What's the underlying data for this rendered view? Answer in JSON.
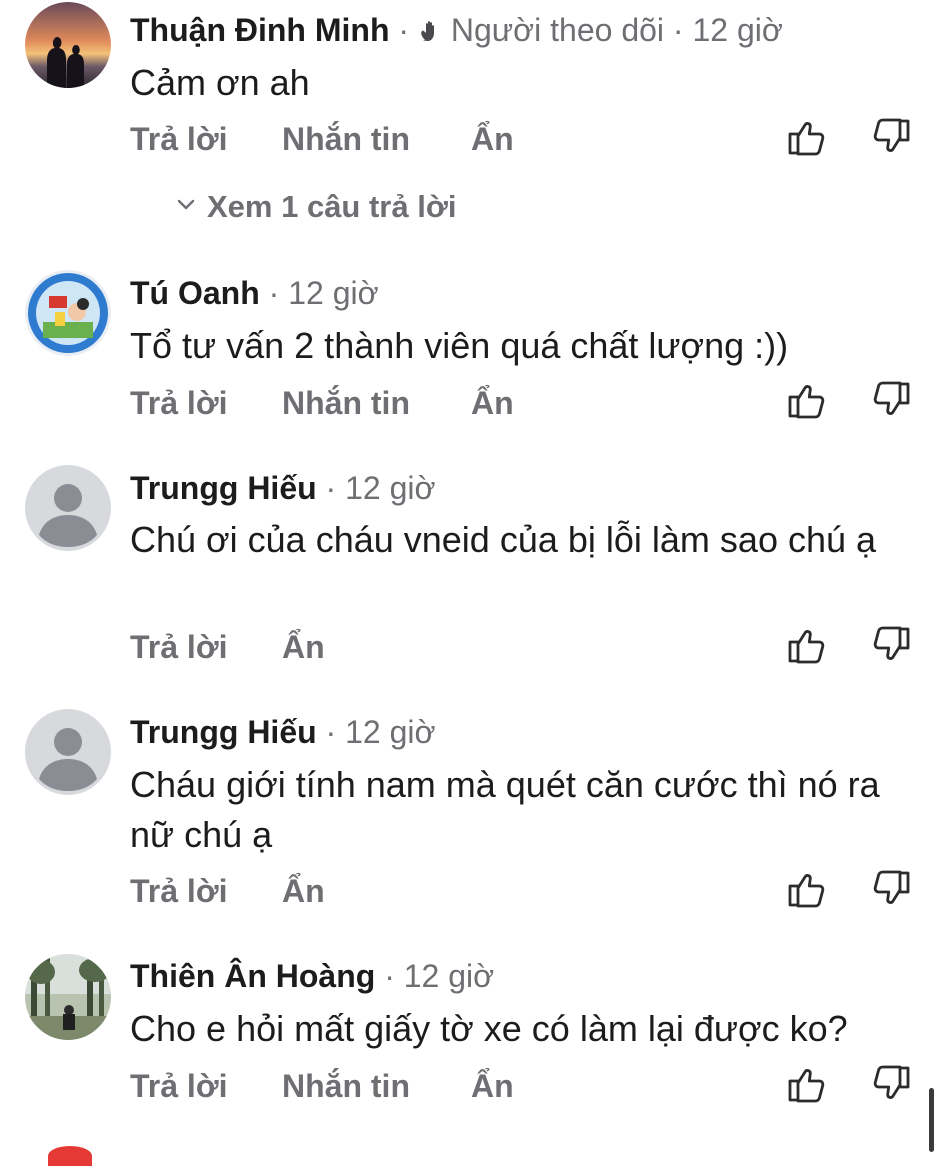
{
  "comments": [
    {
      "author": "Thuận Đinh Minh",
      "badge": "Người theo dõi",
      "time": "· 12 giờ",
      "text": "Cảm ơn ah",
      "actions": [
        "Trả lời",
        "Nhắn tin",
        "Ẩn"
      ],
      "replies_label": "Xem 1 câu trả lời"
    },
    {
      "author": "Tú Oanh",
      "time": "· 12 giờ",
      "text": "Tổ tư vấn 2 thành viên quá chất lượng :))",
      "actions": [
        "Trả lời",
        "Nhắn tin",
        "Ẩn"
      ]
    },
    {
      "author": "Trungg Hiếu",
      "time": "· 12 giờ",
      "text": "Chú ơi của cháu vneid của bị lỗi làm sao chú ạ",
      "actions": [
        "Trả lời",
        "Ẩn"
      ]
    },
    {
      "author": "Trungg Hiếu",
      "time": "· 12 giờ",
      "text": "Cháu giới tính nam mà quét căn cước thì nó ra nữ chú ạ",
      "actions": [
        "Trả lời",
        "Ẩn"
      ]
    },
    {
      "author": "Thiên Ân Hoàng",
      "time": "· 12 giờ",
      "text": "Cho e hỏi mất giấy tờ xe có làm lại được ko?",
      "actions": [
        "Trả lời",
        "Nhắn tin",
        "Ẩn"
      ]
    }
  ],
  "icons": {
    "like": "thumbs-up-icon",
    "dislike": "thumbs-down-icon",
    "follower": "wave-hand-icon",
    "expand": "chevron-down-icon"
  },
  "colors": {
    "text": "#1c1c1e",
    "secondary": "#6e6e73",
    "placeholder_avatar": "#d7d9dd"
  }
}
